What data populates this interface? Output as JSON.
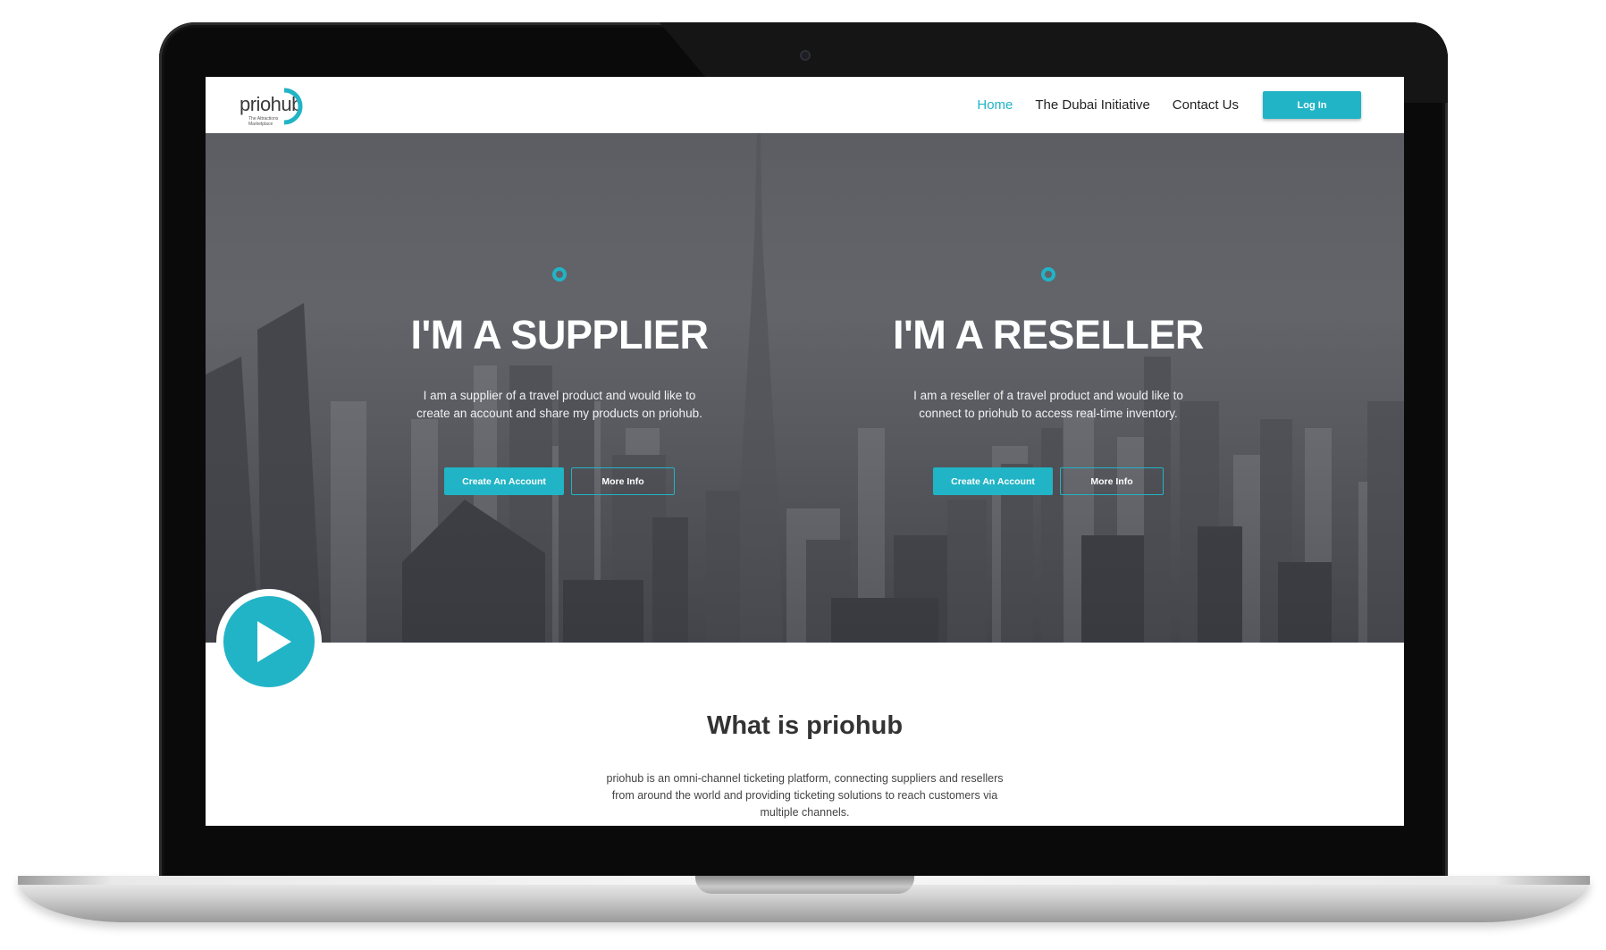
{
  "colors": {
    "accent": "#21b4c6",
    "hero_overlay": "#5b5d63",
    "laptop_bezel": "#0a0a0a"
  },
  "header": {
    "logo_text": "priohub",
    "logo_tagline": "The Attractions Marketplace",
    "nav": [
      {
        "label": "Home",
        "active": true
      },
      {
        "label": "The Dubai Initiative",
        "active": false
      },
      {
        "label": "Contact Us",
        "active": false
      }
    ],
    "login_label": "Log In"
  },
  "hero": {
    "supplier": {
      "icon": "ring-icon",
      "title": "I'M A SUPPLIER",
      "description": "I am a supplier of a travel product and would like to create an account and share my products on priohub.",
      "create_label": "Create An Account",
      "more_label": "More Info"
    },
    "reseller": {
      "icon": "ring-icon",
      "title": "I'M A RESELLER",
      "description": "I am a reseller of a travel product and would like to connect to priohub to access real-time inventory.",
      "create_label": "Create An Account",
      "more_label": "More Info"
    }
  },
  "video": {
    "icon": "play-icon"
  },
  "about": {
    "title": "What is priohub",
    "text": "priohub is an omni-channel ticketing platform, connecting suppliers and resellers from around the world and providing ticketing solutions to reach customers via multiple channels."
  }
}
